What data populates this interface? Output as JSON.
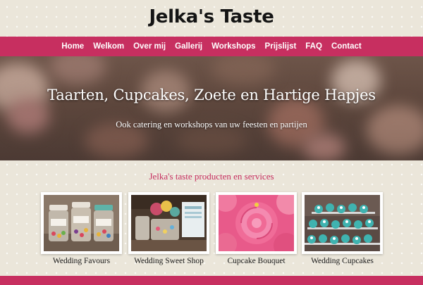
{
  "site": {
    "title": "Jelka's Taste"
  },
  "nav": {
    "items": [
      "Home",
      "Welkom",
      "Over mij",
      "Gallerij",
      "Workshops",
      "Prijslijst",
      "FAQ",
      "Contact"
    ]
  },
  "hero": {
    "title": "Taarten, Cupcakes, Zoete en Hartige Hapjes",
    "subtitle": "Ook catering en workshops van uw feesten en partijen"
  },
  "products": {
    "heading": "Jelka's taste producten en services",
    "items": [
      {
        "label": "Wedding Favours",
        "image": "jars-of-sweets-image"
      },
      {
        "label": "Wedding Sweet Shop",
        "image": "sweet-shop-table-image"
      },
      {
        "label": "Cupcake Bouquet",
        "image": "pink-rose-cupcakes-image"
      },
      {
        "label": "Wedding Cupcakes",
        "image": "teal-cupcake-tower-image"
      }
    ]
  },
  "colors": {
    "accent": "#c72f60",
    "background": "#ebe6da",
    "title_text": "#141414"
  }
}
